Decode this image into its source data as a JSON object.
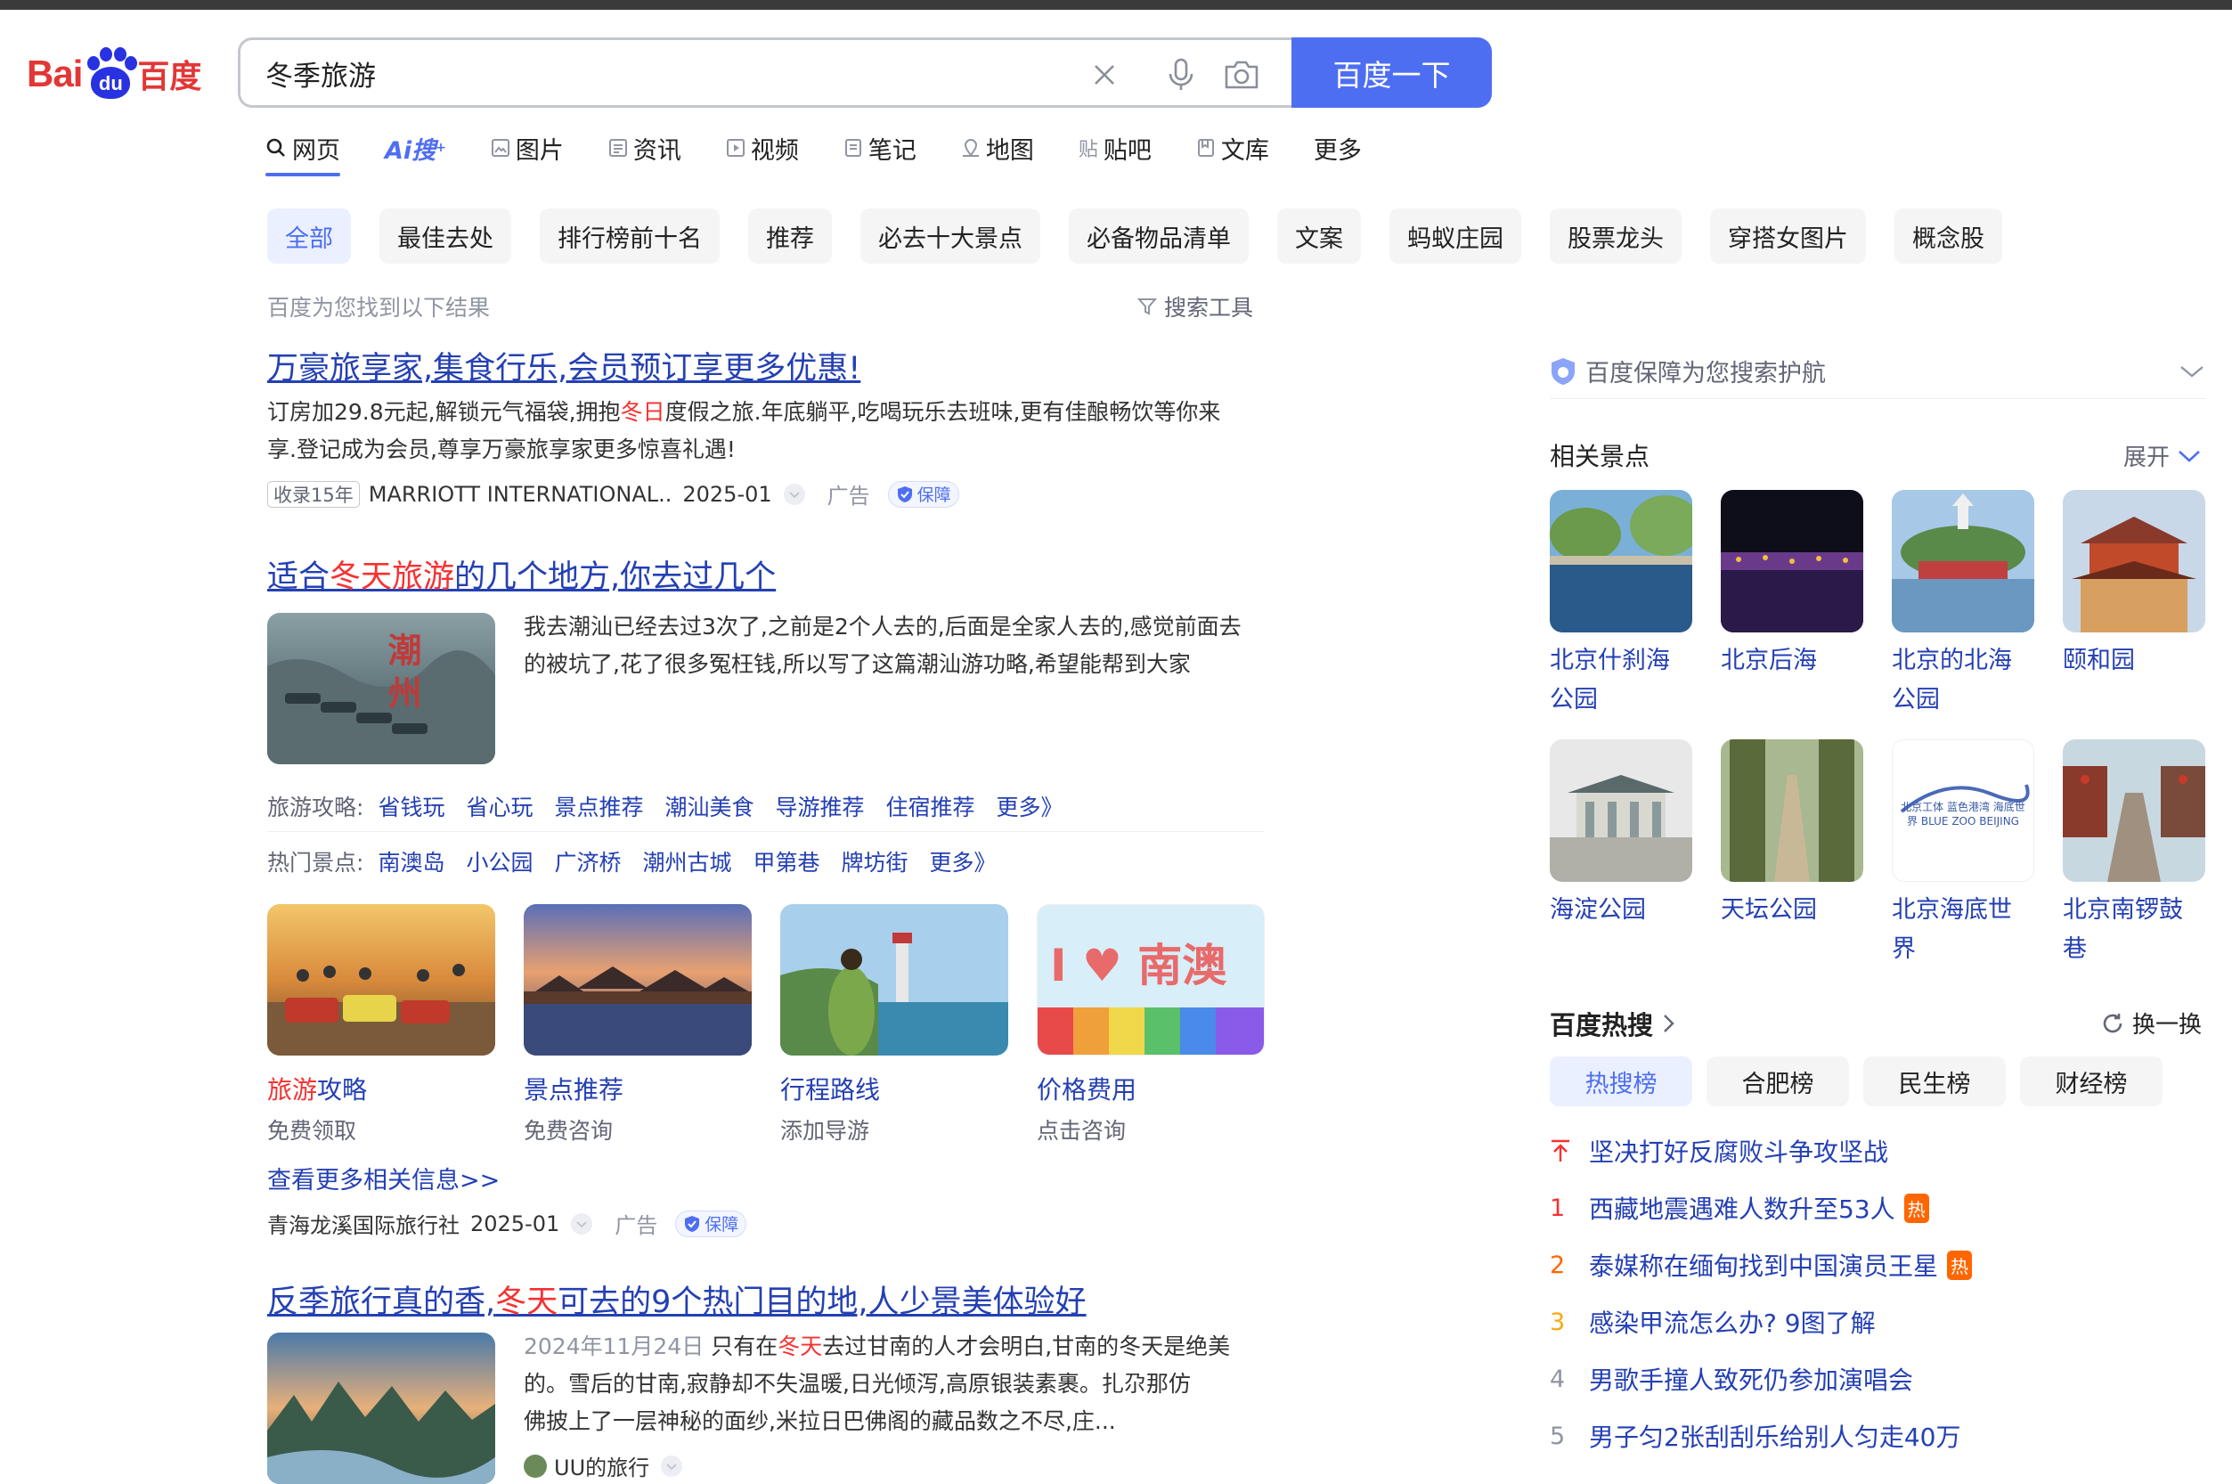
{
  "colors": {
    "brand_red": "#e33636",
    "brand_blue": "#2932e1",
    "accent": "#4e6ef2",
    "link": "#2440b3",
    "highlight": "#f73131"
  },
  "logo": {
    "left": "Bai",
    "paw": "du",
    "right": "百度"
  },
  "search": {
    "query": "冬季旅游",
    "button": "百度一下"
  },
  "tabs": [
    {
      "label": "网页",
      "icon": "search-icon"
    },
    {
      "label": "Ai搜",
      "icon": "ai-icon"
    },
    {
      "label": "图片",
      "icon": "image-icon"
    },
    {
      "label": "资讯",
      "icon": "news-icon"
    },
    {
      "label": "视频",
      "icon": "video-icon"
    },
    {
      "label": "笔记",
      "icon": "note-icon"
    },
    {
      "label": "地图",
      "icon": "map-icon"
    },
    {
      "label": "贴吧",
      "icon": "tieba-icon"
    },
    {
      "label": "文库",
      "icon": "doc-icon"
    },
    {
      "label": "更多",
      "icon": ""
    }
  ],
  "chips": [
    "全部",
    "最佳去处",
    "排行榜前十名",
    "推荐",
    "必去十大景点",
    "必备物品清单",
    "文案",
    "蚂蚁庄园",
    "股票龙头",
    "穿搭女图片",
    "概念股"
  ],
  "found": "百度为您找到以下结果",
  "tools": "搜索工具",
  "r1": {
    "title": "万豪旅享家,集食行乐,会员预订享更多优惠!",
    "desc1a": "订房加29.8元起,解锁元气福袋,拥抱",
    "desc1hl": "冬日",
    "desc1b": "度假之旅.年底躺平,吃喝玩乐去班味,更有佳酿畅饮等你来",
    "desc2": "享.登记成为会员,尊享万豪旅享家更多惊喜礼遇!",
    "badge": "收录15年",
    "source": "MARRIOTT INTERNATIONAL..",
    "date": "2025-01",
    "ad": "广告",
    "bao": "保障"
  },
  "r2": {
    "title_a": "适合",
    "title_hl": "冬天旅游",
    "title_b": "的几个地方,你去过几个",
    "desc1": "我去潮汕已经去过3次了,之前是2个人去的,后面是全家人去的,感觉前面去",
    "desc2": "的被坑了,花了很多冤枉钱,所以写了这篇潮汕游功略,希望能帮到大家",
    "img_text": "潮州",
    "links1_label": "旅游攻略:",
    "links1": [
      "省钱玩",
      "省心玩",
      "景点推荐",
      "潮汕美食",
      "导游推荐",
      "住宿推荐",
      "更多》"
    ],
    "links2_label": "热门景点:",
    "links2": [
      "南澳岛",
      "小公园",
      "广济桥",
      "潮州古城",
      "甲第巷",
      "牌坊街",
      "更多》"
    ],
    "cards": [
      {
        "title_hl": "旅游",
        "title": "攻略",
        "sub": "免费领取"
      },
      {
        "title_hl": "",
        "title": "景点推荐",
        "sub": "免费咨询"
      },
      {
        "title_hl": "",
        "title": "行程路线",
        "sub": "添加导游"
      },
      {
        "title_hl": "",
        "title": "价格费用",
        "sub": "点击咨询"
      }
    ],
    "card4_img_text": "I ♥ 南澳",
    "more": "查看更多相关信息>>",
    "source": "青海龙溪国际旅行社",
    "date": "2025-01",
    "ad": "广告",
    "bao": "保障"
  },
  "r3": {
    "title_a": "反季旅行真的香,",
    "title_hl": "冬天",
    "title_b": "可去的9个热门目的地,人少景美体验好",
    "date": "2024年11月24日",
    "desc1a": " 只有在",
    "desc1hl": "冬天",
    "desc1b": "去过甘南的人才会明白,甘南的冬天是绝美",
    "desc2": "的。雪后的甘南,寂静却不失温暖,日光倾泻,高原银装素裹。扎尕那仿",
    "desc3": "佛披上了一层神秘的面纱,米拉日巴佛阁的藏品数之不尽,庄...",
    "author": "UU的旅行"
  },
  "right": {
    "guard": "百度保障为您搜索护航",
    "spots_title": "相关景点",
    "expand": "展开",
    "spots": [
      {
        "name": "北京什刹海公园"
      },
      {
        "name": "北京后海"
      },
      {
        "name": "北京的北海公园"
      },
      {
        "name": "颐和园"
      },
      {
        "name": "海淀公园"
      },
      {
        "name": "天坛公园"
      },
      {
        "name": "北京海底世界"
      },
      {
        "name": "北京南锣鼓巷"
      }
    ],
    "spot7_img_text": "北京工体 蓝色港湾 海底世界 BLUE ZOO BEIJING",
    "hot_title": "百度热搜",
    "refresh": "换一换",
    "hot_tabs": [
      "热搜榜",
      "合肥榜",
      "民生榜",
      "财经榜"
    ],
    "hot": [
      {
        "rank": "",
        "text": "坚决打好反腐败斗争攻坚战",
        "tag": ""
      },
      {
        "rank": "1",
        "text": "西藏地震遇难人数升至53人",
        "tag": "热"
      },
      {
        "rank": "2",
        "text": "泰媒称在缅甸找到中国演员王星",
        "tag": "热"
      },
      {
        "rank": "3",
        "text": "感染甲流怎么办? 9图了解",
        "tag": ""
      },
      {
        "rank": "4",
        "text": "男歌手撞人致死仍参加演唱会",
        "tag": ""
      },
      {
        "rank": "5",
        "text": "男子匀2张刮刮乐给别人匀走40万",
        "tag": ""
      }
    ]
  }
}
